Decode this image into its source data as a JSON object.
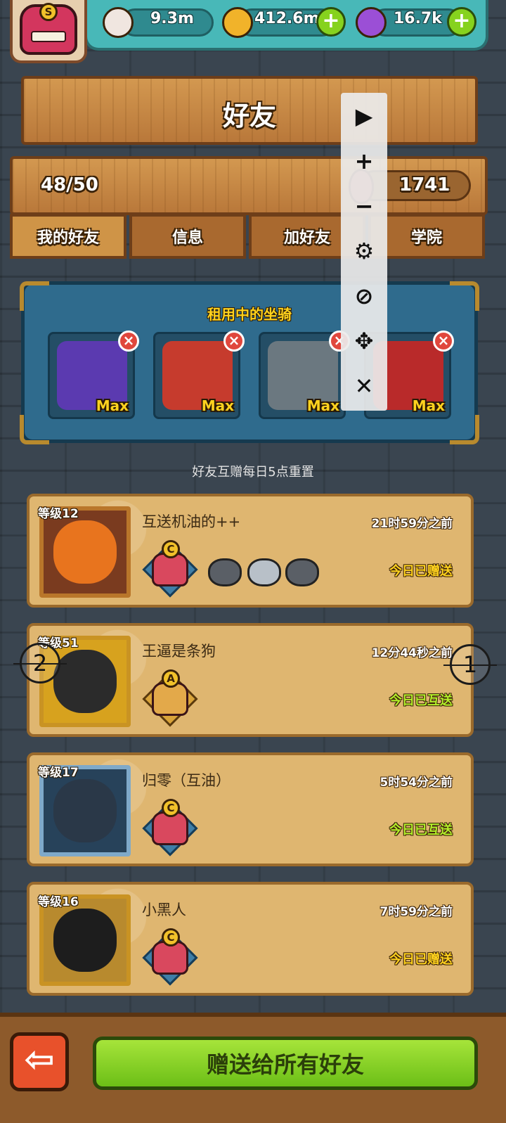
{
  "resources": {
    "eyes": "9.3m",
    "coins": "412.6m",
    "potions": "16.7k",
    "plus_symbol": "+"
  },
  "avatar": {
    "rank_letter": "S"
  },
  "title": "好友",
  "friend_count": "48/50",
  "fuel_count": "1741",
  "tabs": [
    "我的好友",
    "信息",
    "加好友",
    "学院"
  ],
  "active_tab": 0,
  "rented_mounts": {
    "title": "租用中的坐骑",
    "items": [
      {
        "name": "purple-rose-mount-icon",
        "level": "Max",
        "color": "#5b3ab0"
      },
      {
        "name": "lion-dance-mount-icon",
        "level": "Max",
        "color": "#c63b2d"
      },
      {
        "name": "steam-engine-mount-icon",
        "level": "Max",
        "color": "#6b7880"
      },
      {
        "name": "red-horned-monster-mount-icon",
        "level": "Max",
        "color": "#b92a2a"
      }
    ],
    "remove_symbol": "×"
  },
  "reset_note": "好友互赠每日5点重置",
  "friends": [
    {
      "level": "等级12",
      "name": "互送机油的++",
      "time": "21时59分之前",
      "status": "今日已赠送",
      "rank": "C",
      "avatar_color": "#e8741e"
    },
    {
      "level": "等级51",
      "name": "王逼是条狗",
      "time": "12分44秒之前",
      "status": "今日已互送",
      "rank": "A",
      "avatar_color": "#2b2b2b"
    },
    {
      "level": "等级17",
      "name": "归零（互油）",
      "time": "5时54分之前",
      "status": "今日已互送",
      "rank": "C",
      "avatar_color": "#2a3848"
    },
    {
      "level": "等级16",
      "name": "小黑人",
      "time": "7时59分之前",
      "status": "今日已赠送",
      "rank": "C",
      "avatar_color": "#1d1d1d"
    }
  ],
  "markers": [
    "1",
    "2"
  ],
  "overlay_tools": [
    "play-icon",
    "plus-icon",
    "minus-icon",
    "gear-icon",
    "eye-off-icon",
    "move-icon",
    "close-icon"
  ],
  "overlay_glyphs": [
    "▶",
    "+",
    "−",
    "⚙",
    "⊘",
    "✥",
    "✕"
  ],
  "back_glyph": "⇦",
  "gift_all_label": "赠送给所有好友"
}
